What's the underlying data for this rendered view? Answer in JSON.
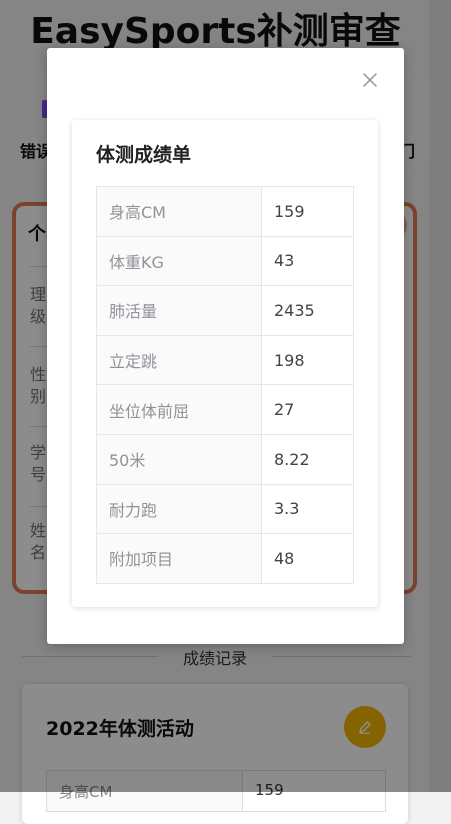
{
  "app": {
    "title": "EasySports补测审查",
    "nav": {
      "left_label": "错误",
      "right_label": "门"
    },
    "info": {
      "header": "个",
      "rows": [
        "理级",
        "性别",
        "学号",
        "姓名"
      ]
    },
    "divider_label": "成绩记录",
    "activity": {
      "title": "2022年体测活动",
      "edit_icon": "pencil-icon",
      "rows": [
        {
          "label": "身高CM",
          "value": "159"
        }
      ]
    }
  },
  "modal": {
    "close_icon": "close-icon",
    "card_title": "体测成绩单",
    "rows": [
      {
        "label": "身高CM",
        "value": "159"
      },
      {
        "label": "体重KG",
        "value": "43"
      },
      {
        "label": "肺活量",
        "value": "2435"
      },
      {
        "label": "立定跳",
        "value": "198"
      },
      {
        "label": "坐位体前屈",
        "value": "27"
      },
      {
        "label": "50米",
        "value": "8.22"
      },
      {
        "label": "耐力跑",
        "value": "3.3"
      },
      {
        "label": "附加项目",
        "value": "48"
      }
    ]
  },
  "colors": {
    "accent": "#e07b53",
    "edit_button": "#f0b400",
    "nav_icon": "#7c4dff"
  }
}
